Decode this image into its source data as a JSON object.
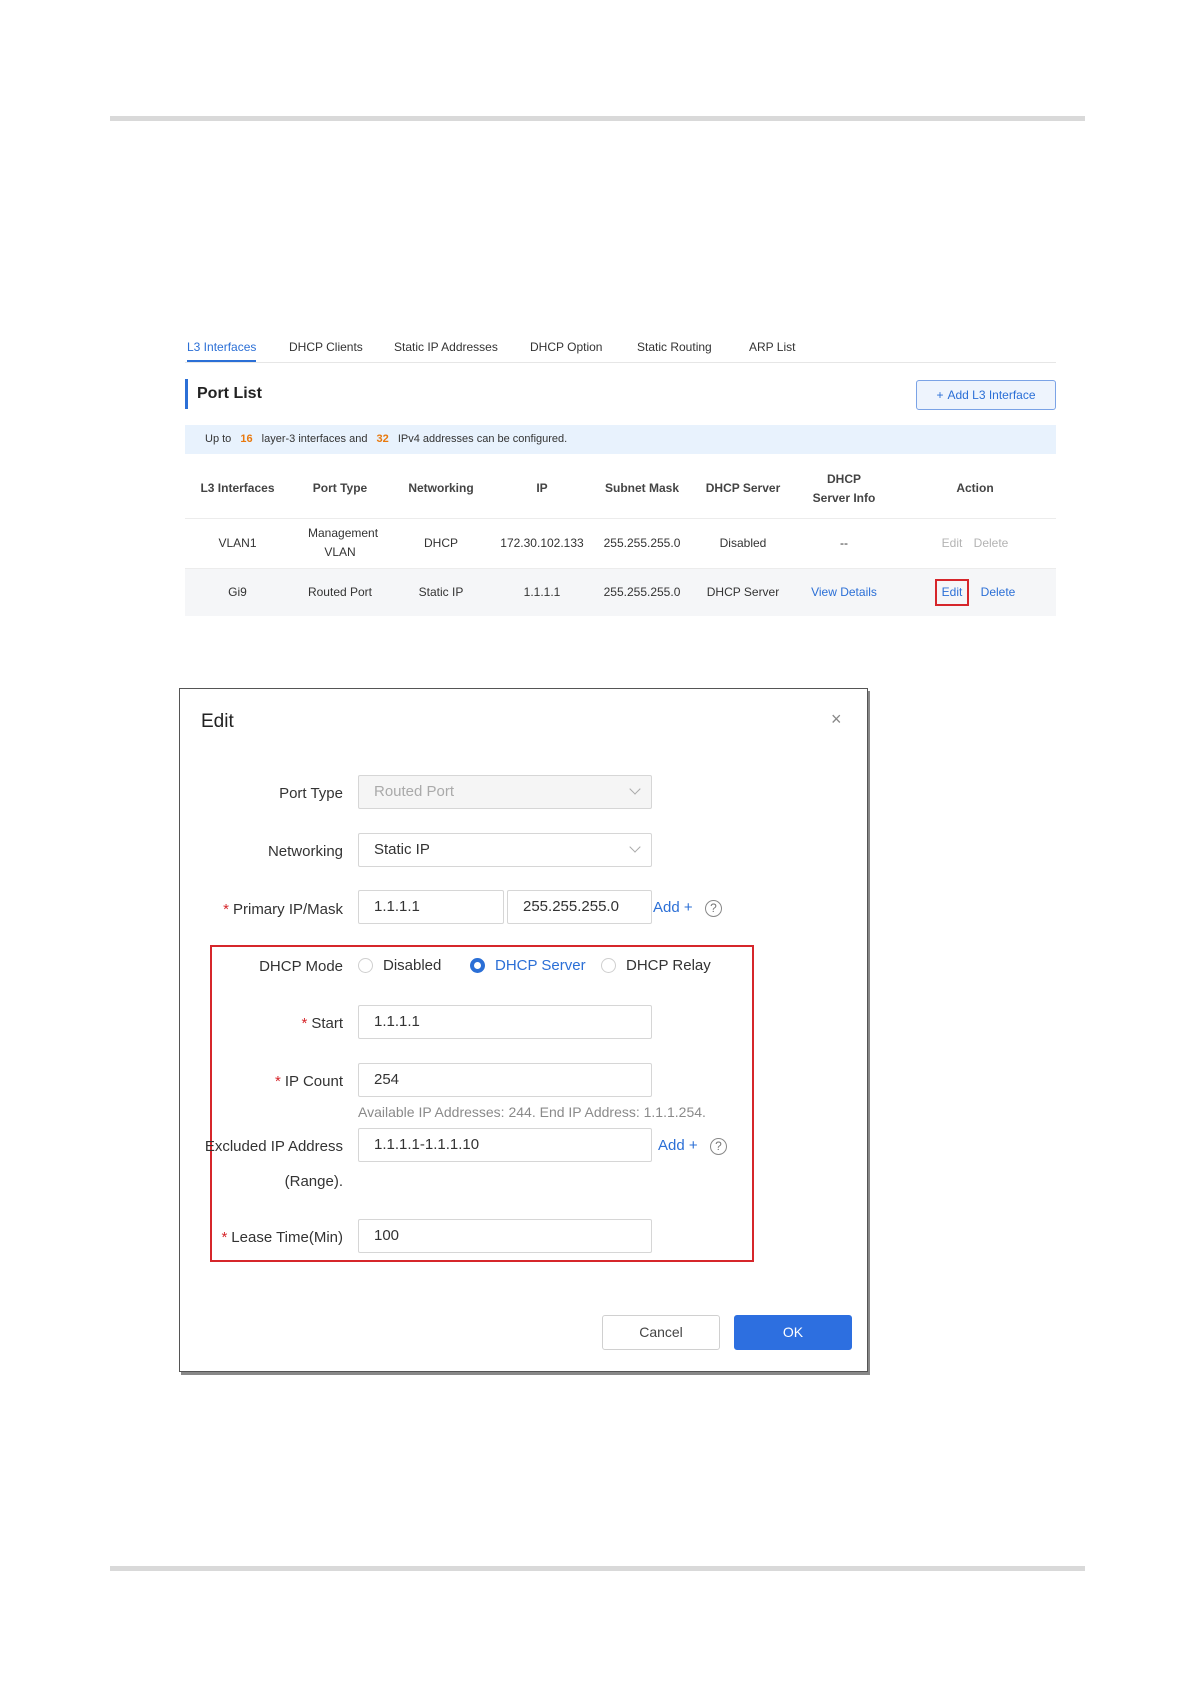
{
  "tabs": [
    {
      "label": "L3 Interfaces",
      "active": true
    },
    {
      "label": "DHCP Clients"
    },
    {
      "label": "Static IP Addresses"
    },
    {
      "label": "DHCP Option"
    },
    {
      "label": "Static Routing"
    },
    {
      "label": "ARP List"
    }
  ],
  "port_list": {
    "title": "Port List",
    "add_button": "Add L3 Interface",
    "notice": {
      "prefix": "Up to",
      "interfaces_max": "16",
      "middle": "layer-3 interfaces and",
      "ipv4_max": "32",
      "suffix": "IPv4 addresses can be configured."
    },
    "columns": [
      "L3 Interfaces",
      "Port Type",
      "Networking",
      "IP",
      "Subnet Mask",
      "DHCP Server",
      "DHCP Server Info",
      "Action"
    ],
    "rows": [
      {
        "interface": "VLAN1",
        "port_type": "Management VLAN",
        "networking": "DHCP",
        "ip": "172.30.102.133",
        "mask": "255.255.255.0",
        "dhcp_server": "Disabled",
        "dhcp_info": "--",
        "edit": "Edit",
        "delete": "Delete"
      },
      {
        "interface": "Gi9",
        "port_type": "Routed Port",
        "networking": "Static IP",
        "ip": "1.1.1.1",
        "mask": "255.255.255.0",
        "dhcp_server": "DHCP Server",
        "dhcp_info": "View Details",
        "edit": "Edit",
        "delete": "Delete"
      }
    ]
  },
  "dialog": {
    "title": "Edit",
    "close_icon": "×",
    "port_type": {
      "label": "Port Type",
      "value": "Routed Port"
    },
    "networking": {
      "label": "Networking",
      "value": "Static IP"
    },
    "primary_ip": {
      "label": "Primary IP/Mask",
      "ip": "1.1.1.1",
      "mask": "255.255.255.0",
      "add": "Add +"
    },
    "dhcp_mode": {
      "label": "DHCP Mode",
      "options": [
        "Disabled",
        "DHCP Server",
        "DHCP Relay"
      ],
      "selected": "DHCP Server"
    },
    "start": {
      "label": "Start",
      "value": "1.1.1.1"
    },
    "ip_count": {
      "label": "IP Count",
      "value": "254",
      "hint": "Available IP Addresses: 244. End IP Address: 1.1.1.254."
    },
    "excluded": {
      "label_line1": "Excluded IP Address",
      "label_line2": "(Range).",
      "value": "1.1.1.1-1.1.1.10",
      "add": "Add +"
    },
    "lease": {
      "label": "Lease Time(Min)",
      "value": "100"
    },
    "cancel": "Cancel",
    "ok": "OK"
  },
  "colors": {
    "accent": "#2b6fd6",
    "highlight_border": "#d6262b",
    "warning_number": "#e8790e",
    "ok_button": "#2d6fe0"
  }
}
